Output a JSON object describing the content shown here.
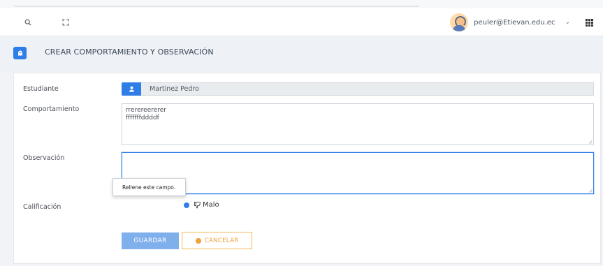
{
  "header": {
    "search_icon": "search-icon",
    "fullscreen_icon": "fullscreen-icon",
    "user_email": "peuler@Etievan.edu.ec",
    "dropdown_glyph": "⌄",
    "apps_icon": "grid-icon"
  },
  "page": {
    "title": "CREAR COMPORTAMIENTO Y OBSERVACIÓN",
    "title_icon": "ghost-icon"
  },
  "form": {
    "student": {
      "label": "Estudiante",
      "value": "Martinez Pedro",
      "icon": "user-icon"
    },
    "behavior": {
      "label": "Comportamiento",
      "lines": [
        "rrerereererer",
        "fffffffddddf"
      ]
    },
    "observation": {
      "label": "Observación",
      "value": ""
    },
    "rating": {
      "label": "Calificación",
      "tooltip": "Rellene este campo.",
      "option_label": "Malo",
      "option_icon": "thumbs-down-icon"
    },
    "buttons": {
      "save": "GUARDAR",
      "cancel": "CANCELAR"
    }
  },
  "colors": {
    "accent": "#2f7ee8",
    "save_button": "#7fb0ec",
    "cancel_border": "#f5b95a",
    "cancel_text": "#f0a64a"
  }
}
